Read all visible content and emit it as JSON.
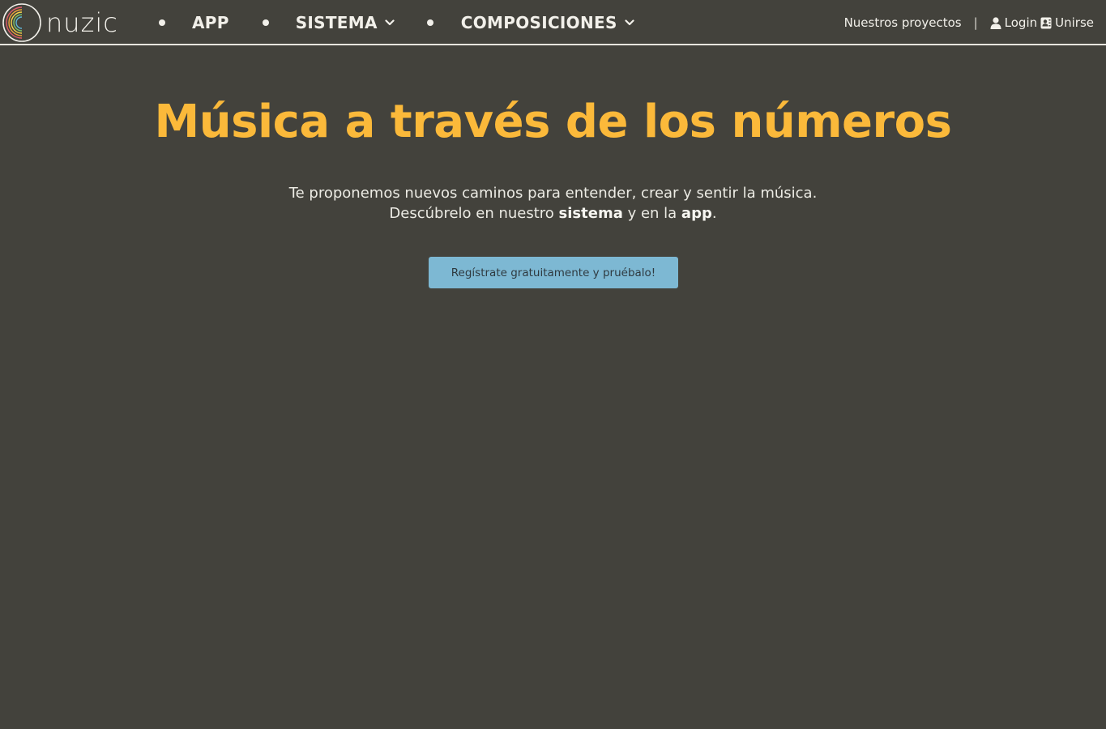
{
  "brand": {
    "name": "nuzic",
    "ring_colors": [
      "#e35d6a",
      "#f0a33a",
      "#f6d54a",
      "#7cc36b",
      "#5fb7d6"
    ]
  },
  "nav": {
    "items": [
      {
        "label": "APP",
        "has_dropdown": false
      },
      {
        "label": "SISTEMA",
        "has_dropdown": true
      },
      {
        "label": "COMPOSICIONES",
        "has_dropdown": true
      }
    ],
    "right": {
      "projects_label": "Nuestros proyectos",
      "separator": "|",
      "login_label": "Login",
      "join_label": "Unirse"
    }
  },
  "hero": {
    "title": "Música a través de los números",
    "line1": "Te proponemos nuevos caminos para entender, crear y sentir la música.",
    "line2_prefix": "Descúbrelo en nuestro ",
    "line2_system": "sistema",
    "line2_middle": " y en la ",
    "line2_app": "app",
    "line2_suffix": ".",
    "cta_label": "Regístrate gratuitamente y pruébalo!"
  },
  "colors": {
    "background": "#43423c",
    "title": "#fbb93a",
    "cta_bg": "#7db8d3",
    "text": "#f2f0ea"
  }
}
